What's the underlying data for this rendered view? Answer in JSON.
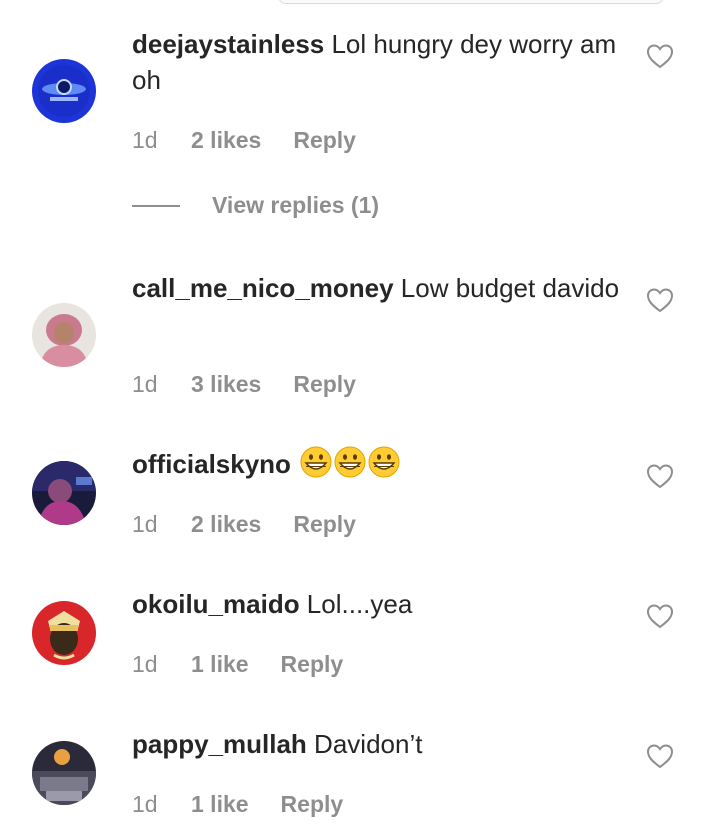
{
  "comments": [
    {
      "user": "deejaystainless",
      "text": " Lol hungry dey worry am oh",
      "time": "1d",
      "likes": "2 likes",
      "reply": "Reply"
    },
    {
      "user": "call_me_nico_money",
      "text": " Low budget davido",
      "time": "1d",
      "likes": "3 likes",
      "reply": "Reply"
    },
    {
      "user": "officialskyno",
      "text": " ",
      "emoji": [
        "grinning-face",
        "grinning-face",
        "grinning-face"
      ],
      "time": "1d",
      "likes": "2 likes",
      "reply": "Reply"
    },
    {
      "user": "okoilu_maido",
      "text": " Lol....yea",
      "time": "1d",
      "likes": "1 like",
      "reply": "Reply"
    },
    {
      "user": "pappy_mullah",
      "text": " Davidon’t",
      "time": "1d",
      "likes": "1 like",
      "reply": "Reply"
    }
  ],
  "view_replies": "View replies (1)",
  "colors": {
    "text": "#262626",
    "secondary": "#8e8e8e"
  }
}
